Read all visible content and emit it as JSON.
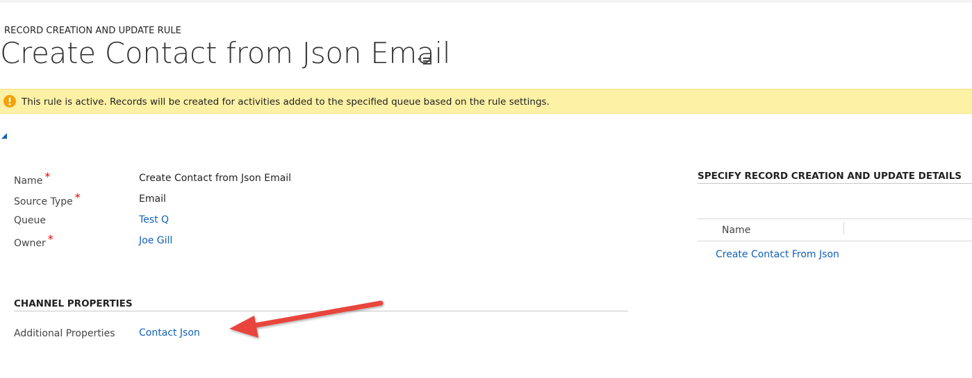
{
  "header": {
    "entity_label": "RECORD CREATION AND UPDATE RULE",
    "title": "Create Contact from Json Email",
    "menu_icon": "menu-list-icon"
  },
  "notification": {
    "icon": "warning-icon",
    "text": "This rule is active. Records will be created for activities added to the specified queue based on the rule settings.",
    "color": "#fdf1a5",
    "icon_color": "#f0a30a"
  },
  "general": {
    "fields": [
      {
        "label": "Name",
        "required": true,
        "value": "Create Contact from Json Email",
        "is_link": false
      },
      {
        "label": "Source Type",
        "required": true,
        "value": "Email",
        "is_link": false
      },
      {
        "label": "Queue",
        "required": false,
        "value": "Test Q",
        "is_link": true
      },
      {
        "label": "Owner",
        "required": true,
        "value": "Joe Gill",
        "is_link": true
      }
    ],
    "required_marker": "*"
  },
  "channel_properties": {
    "header": "CHANNEL PROPERTIES",
    "fields": [
      {
        "label": "Additional Properties",
        "value": "Contact Json",
        "is_link": true
      }
    ]
  },
  "record_details": {
    "header": "SPECIFY RECORD CREATION AND UPDATE DETAILS",
    "grid": {
      "columns": [
        "Name"
      ],
      "rows": [
        "Create Contact From Json"
      ]
    }
  },
  "colors": {
    "link": "#1160b7",
    "annotation_arrow": "#e8453c"
  }
}
